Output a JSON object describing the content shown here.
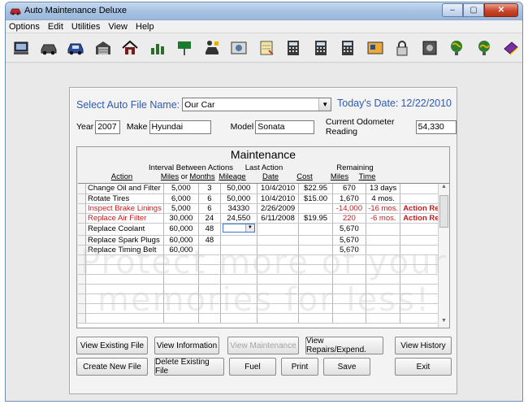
{
  "window": {
    "title": "Auto Maintenance Deluxe",
    "min_label": "–",
    "max_label": "▢",
    "close_label": "✕"
  },
  "menu": [
    "Options",
    "Edit",
    "Utilities",
    "View",
    "Help"
  ],
  "toolbar": [
    {
      "icon": "computer-icon"
    },
    {
      "icon": "car-icon"
    },
    {
      "icon": "car-blue-icon"
    },
    {
      "icon": "garage-icon"
    },
    {
      "icon": "house-icon"
    },
    {
      "icon": "chart-icon"
    },
    {
      "icon": "road-sign-icon"
    },
    {
      "icon": "person-car-icon"
    },
    {
      "icon": "photo-icon"
    },
    {
      "icon": "notepad-icon"
    },
    {
      "icon": "calculator-icon"
    },
    {
      "icon": "calculator2-icon"
    },
    {
      "icon": "calculator3-icon"
    },
    {
      "icon": "card-icon"
    },
    {
      "icon": "lock-icon"
    },
    {
      "icon": "safe-icon"
    },
    {
      "icon": "globe-icon"
    },
    {
      "icon": "globe2-icon"
    },
    {
      "icon": "book-icon"
    },
    {
      "icon": "exit-icon"
    }
  ],
  "file": {
    "select_label": "Select Auto File Name:",
    "selected": "Our Car",
    "today_label": "Today's Date:",
    "today": "12/22/2010"
  },
  "vehicle": {
    "year_label": "Year",
    "year": "2007",
    "make_label": "Make",
    "make": "Hyundai",
    "model_label": "Model",
    "model": "Sonata",
    "odometer_label": "Current Odometer Reading",
    "odometer": "54,330"
  },
  "maintenance": {
    "title": "Maintenance",
    "hdr_interval": "Interval Between Actions",
    "hdr_last": "Last Action",
    "hdr_remaining": "Remaining",
    "col_action": "Action",
    "col_miles": "Miles",
    "col_or": "or",
    "col_months": "Months",
    "col_mileage": "Mileage",
    "col_date": "Date",
    "col_cost": "Cost",
    "col_rem_miles": "Miles",
    "col_rem_time": "Time",
    "rows": [
      {
        "action": "Change Oil and Filter",
        "miles": "5,000",
        "months": "3",
        "mileage": "50,000",
        "date": "10/4/2010",
        "cost": "$22.95",
        "rem_miles": "670",
        "rem_time": "13 days",
        "status": "",
        "alert": false
      },
      {
        "action": "Rotate Tires",
        "miles": "6,000",
        "months": "6",
        "mileage": "50,000",
        "date": "10/4/2010",
        "cost": "$15.00",
        "rem_miles": "1,670",
        "rem_time": "4 mos.",
        "status": "",
        "alert": false
      },
      {
        "action": "Inspect Brake Linings",
        "miles": "5,000",
        "months": "6",
        "mileage": "34330",
        "date": "2/26/2009",
        "cost": "",
        "rem_miles": "-14,000",
        "rem_time": "-16 mos.",
        "status": "Action Req.",
        "alert": true
      },
      {
        "action": "Replace Air Filter",
        "miles": "30,000",
        "months": "24",
        "mileage": "24,550",
        "date": "6/11/2008",
        "cost": "$19.95",
        "rem_miles": "220",
        "rem_time": "-6 mos.",
        "status": "Action Req.",
        "alert": true
      },
      {
        "action": "Replace Coolant",
        "miles": "60,000",
        "months": "48",
        "mileage": "",
        "date": "",
        "cost": "",
        "rem_miles": "5,670",
        "rem_time": "",
        "status": "",
        "alert": false
      },
      {
        "action": "Replace Spark Plugs",
        "miles": "60,000",
        "months": "48",
        "mileage": "",
        "date": "",
        "cost": "",
        "rem_miles": "5,670",
        "rem_time": "",
        "status": "",
        "alert": false
      },
      {
        "action": "Replace Timing Belt",
        "miles": "60,000",
        "months": "",
        "mileage": "",
        "date": "",
        "cost": "",
        "rem_miles": "5,670",
        "rem_time": "",
        "status": "",
        "alert": false
      }
    ]
  },
  "buttons": {
    "view_existing": "View Existing File",
    "view_information": "View Information",
    "view_maintenance": "View Maintenance",
    "view_repairs": "View Repairs/Expend.",
    "view_history": "View History",
    "create_new": "Create New File",
    "delete_existing": "Delete Existing File",
    "fuel": "Fuel",
    "print": "Print",
    "save": "Save",
    "exit": "Exit"
  },
  "watermark": "Protect more of your memories for less!",
  "colors": {
    "accent_blue": "#2f59b7",
    "alert_red": "#c51d1d"
  }
}
